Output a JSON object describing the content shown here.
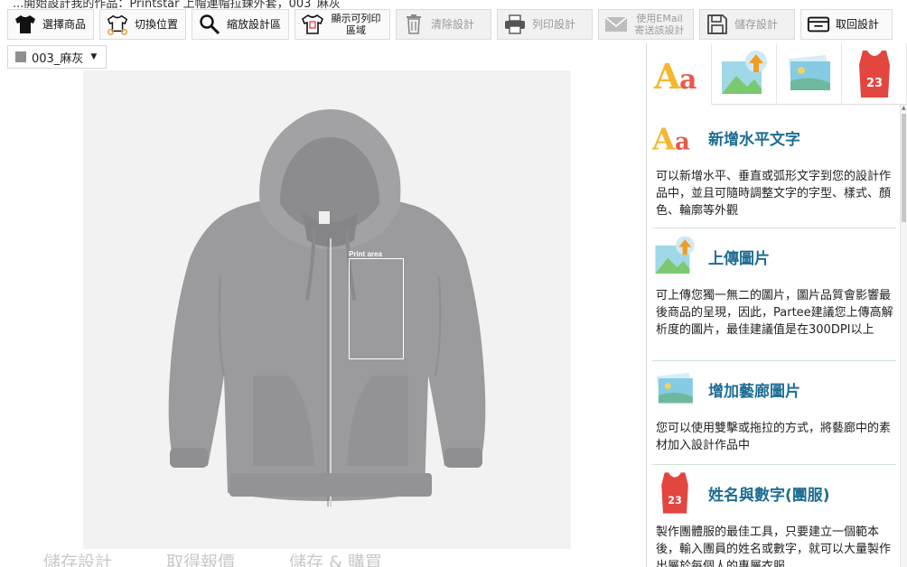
{
  "window_title_fragment": "...開始設計我的作品：Printstar 上帽連帽拉鍊外套，003_麻灰",
  "toolbar": {
    "buttons": [
      {
        "label": "選擇商品",
        "icon": "tshirt-black-icon",
        "disabled": false
      },
      {
        "label": "切換位置",
        "icon": "tshirt-outline-swap-icon",
        "disabled": false
      },
      {
        "label": "縮放設計區",
        "icon": "magnifier-icon",
        "disabled": false
      },
      {
        "label": "顯示可列印區域",
        "icon": "tshirt-print-area-icon",
        "disabled": false
      },
      {
        "label": "清除設計",
        "icon": "trash-icon",
        "disabled": true
      },
      {
        "label": "列印設計",
        "icon": "printer-icon",
        "disabled": true
      },
      {
        "label": "使用EMail寄送該設計",
        "icon": "email-icon",
        "disabled": true
      },
      {
        "label": "儲存設計",
        "icon": "floppy-disk-icon",
        "disabled": true
      },
      {
        "label": "取回設計",
        "icon": "retrieve-tray-icon",
        "disabled": false
      }
    ]
  },
  "color_selector": {
    "value": "003_麻灰",
    "swatch_color": "#8f8f8f"
  },
  "canvas": {
    "print_area_label": "Print area",
    "product_color": "#9c9c9c"
  },
  "bottom_bar": {
    "items": [
      "儲存設計",
      "取得報價",
      "儲存 & 購買"
    ]
  },
  "right_panel": {
    "tabs": [
      "text-tab",
      "upload-tab",
      "gallery-tab",
      "jersey-tab"
    ],
    "features": [
      {
        "title": "新增水平文字",
        "description": "可以新增水平、垂直或弧形文字到您的設計作品中，並且可隨時調整文字的字型、樣式、顏色、輪廓等外觀"
      },
      {
        "title": "上傳圖片",
        "description": "可上傳您獨一無二的圖片，圖片品質會影響最後商品的呈現，因此，Partee建議您上傳高解析度的圖片，最佳建議值是在300DPI以上"
      },
      {
        "title": "增加藝廊圖片",
        "description": "您可以使用雙擊或拖拉的方式，將藝廊中的素材加入設計作品中"
      },
      {
        "title": "姓名與數字(團服)",
        "description": "製作團體服的最佳工具，只要建立一個範本後，輸入團員的姓名或數字，就可以大量製作出屬於每個人的專屬衣服。"
      }
    ],
    "jersey_number": "23",
    "text_icon_glyph": "Aa"
  },
  "colors": {
    "accent_title": "#1e6d93",
    "jersey_red": "#e2463f",
    "text_icon_yellow": "#f3b730",
    "text_icon_red": "#e8584c"
  }
}
